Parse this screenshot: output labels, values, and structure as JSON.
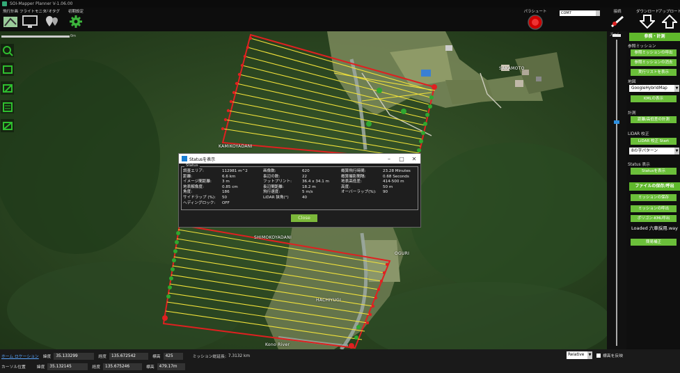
{
  "app": {
    "title": "SOI-Mapper Planner V-1.06.00"
  },
  "toolbar": {
    "tools": [
      {
        "label": "飛行計画",
        "icon": "flight-plan-icon"
      },
      {
        "label": "フライトモニタ",
        "icon": "monitor-icon"
      },
      {
        "label": "ジオタグ",
        "icon": "geotag-icon"
      },
      {
        "label": "初期設定",
        "icon": "gear-icon"
      }
    ],
    "parachute_label": "パラシュート",
    "com_port_value": "COM7",
    "connect_label": "接続",
    "download_label": "ダウンロード",
    "upload_label": "アップロード",
    "zoom_label": "ズーム"
  },
  "map": {
    "scale_label": "0m",
    "place_labels": [
      "SAKAMOTO",
      "KAMIKOYADANI",
      "SHIMOKOYADANI",
      "OGURI",
      "HACHIYUGI",
      "Kono River"
    ]
  },
  "dialog": {
    "title": "Statusを表示",
    "group_label": "Status",
    "rows": [
      [
        "調査エリア:",
        "112981 m^2",
        "画像数:",
        "620",
        "概算飛行時間:",
        "23.28 Minutes"
      ],
      [
        "距離:",
        "6.6 km",
        "長辺の数:",
        "22",
        "概算撮影間隔:",
        "0.68 Seconds"
      ],
      [
        "イメージ間距離:",
        "3 m",
        "フットプリント:",
        "36.4 x 34.1 m",
        "地表高低差:",
        "414-500 m"
      ],
      [
        "地表解像度:",
        "0.85 cm",
        "長辺間距離:",
        "18.2 m",
        "高度:",
        "50 m"
      ],
      [
        "角度:",
        "186",
        "飛行速度:",
        "5 m/s",
        "オーバーラップ(%):",
        "90"
      ],
      [
        "サイドラップ (%):",
        "50",
        "LiDAR 狭角(°)",
        "40",
        "",
        ""
      ],
      [
        "ヘディングロック:",
        "OFF",
        "",
        "",
        "",
        ""
      ]
    ],
    "close_label": "Close"
  },
  "panel": {
    "header_plan": "参照・計測",
    "section_reference": "参照ミッション",
    "btn_call_reference": "参照ミッションの呼出",
    "btn_clear_reference": "参照ミッションの消去",
    "btn_show_list": "実行リストを表示",
    "section_map": "地図",
    "map_select_value": "GoogleHybridMap",
    "btn_kml": "KMLの表示",
    "section_measure": "計測",
    "btn_measure": "距離/高低差の計測",
    "section_lidar": "LiDAR 校正",
    "btn_lidar_start": "LiDAR 校正 Start",
    "lidar_select_value": "8の字パターン",
    "section_status": "Status 表示",
    "btn_status": "Statusを表示",
    "header_file": "ファイルの保存/呼出",
    "btn_save_mission": "ミッションの保存",
    "btn_load_mission": "ミッションの呼出",
    "btn_polygon_kml": "ポリゴン-KML呼出",
    "loaded_text": "Loaded 六車採用.way",
    "btn_correction": "簡易補正"
  },
  "statusbar": {
    "home_label": "ホーム ロケーション",
    "home_lat_label": "緯度",
    "home_lat": "35.133299",
    "home_lon_label": "経度",
    "home_lon": "135.672542",
    "home_alt_label": "標高",
    "home_alt": "425",
    "mission_dist_label": "ミッション総延長:",
    "mission_dist": "7.3132 km",
    "cursor_label": "カーソル位置",
    "cursor_lat_label": "緯度",
    "cursor_lat": "35.132145",
    "cursor_lon_label": "経度",
    "cursor_lon": "135.675246",
    "cursor_alt_label": "標高",
    "cursor_alt": "479.17m",
    "altitude_mode": "Relative",
    "flip_label": "標高を反映"
  },
  "colors": {
    "accent_green": "#6bbf3a",
    "header_green": "#5fb82c",
    "flight_line": "#f2e23a",
    "boundary": "#e02020",
    "link_blue": "#5aa7ff"
  }
}
